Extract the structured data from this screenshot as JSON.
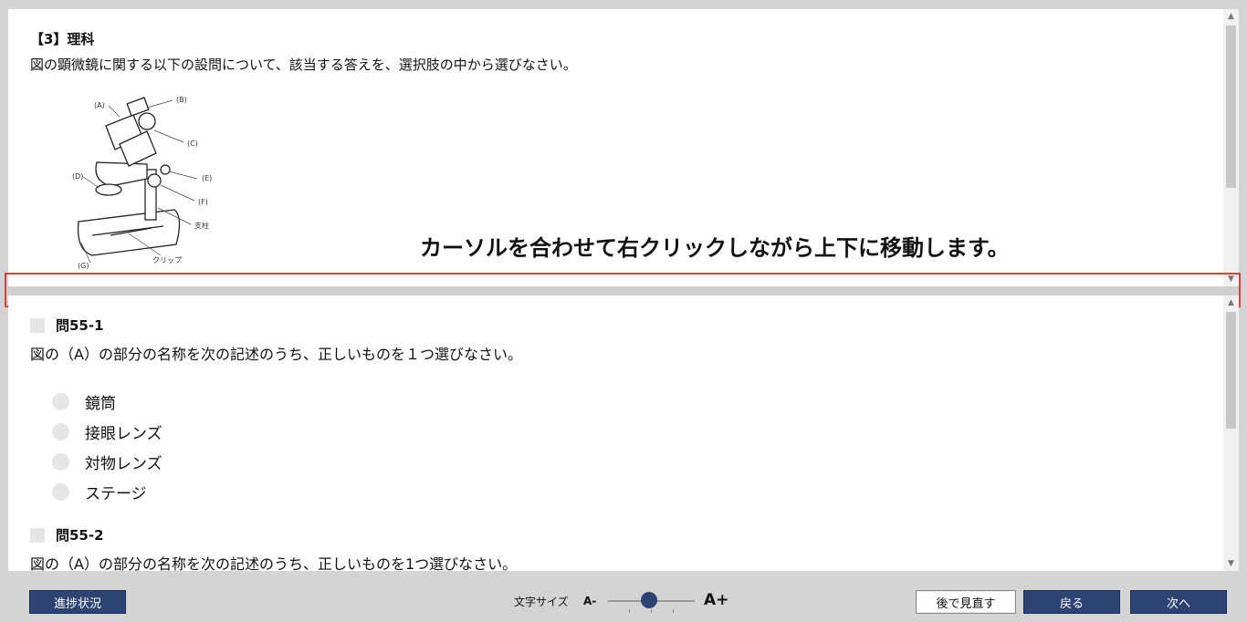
{
  "passage": {
    "section_title": "【3】理科",
    "instruction": "図の顕微鏡に関する以下の設問について、該当する答えを、選択肢の中から選びなさい。",
    "figure_labels": {
      "a": "(A)",
      "b": "(B)",
      "c": "(C)",
      "d": "(D)",
      "e": "(E)",
      "f": "(F)",
      "g": "(G)",
      "pillar": "支柱",
      "clip": "クリップ"
    }
  },
  "hint": "カーソルを合わせて右クリックしながら上下に移動します。",
  "questions": [
    {
      "number": "問55-1",
      "text": "図の（A）の部分の名称を次の記述のうち、正しいものを１つ選びなさい。",
      "options": [
        "鏡筒",
        "接眼レンズ",
        "対物レンズ",
        "ステージ"
      ]
    },
    {
      "number": "問55-2",
      "text": "図の（A）の部分の名称を次の記述のうち、正しいものを1つ選びなさい。"
    }
  ],
  "footer": {
    "progress_label": "進捗状況",
    "font_size_label": "文字サイズ",
    "font_minus": "A-",
    "font_plus": "A+",
    "font_size_level": 0.5,
    "review_label": "後で見直す",
    "back_label": "戻る",
    "next_label": "次へ"
  },
  "colors": {
    "primary_button": "#2d4373",
    "highlight_border": "#e23b3b"
  }
}
